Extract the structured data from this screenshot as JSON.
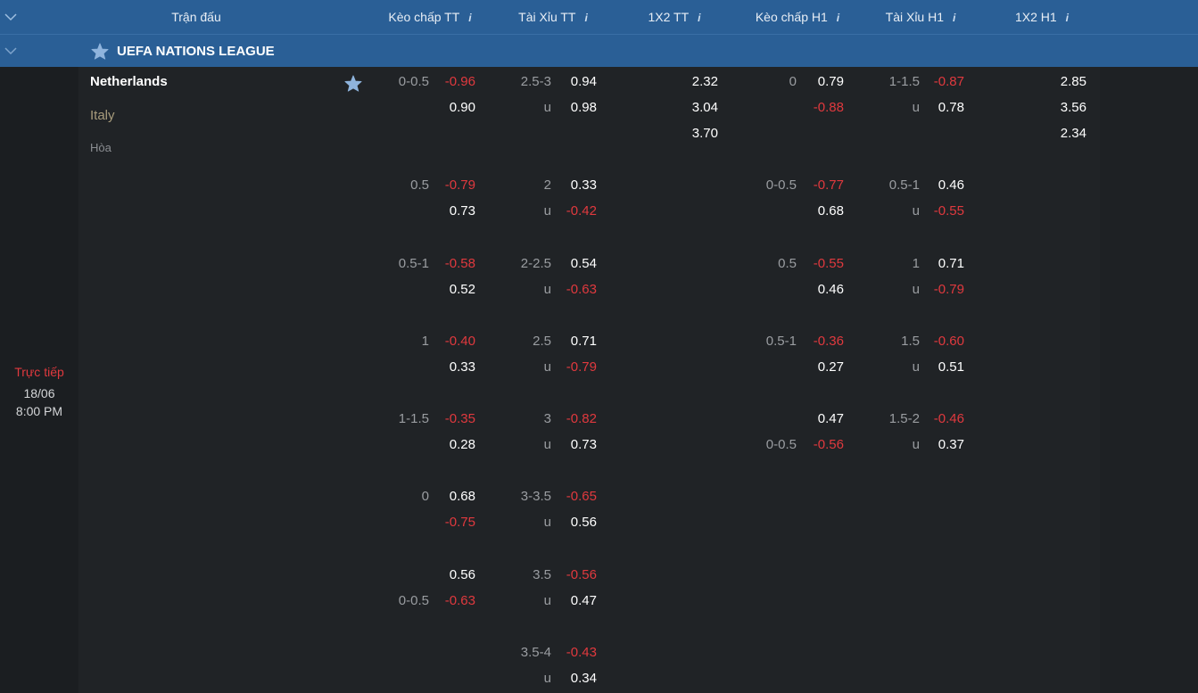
{
  "header": {
    "columns": [
      "Trận đấu",
      "Kèo chấp TT",
      "Tài Xỉu TT",
      "1X2 TT",
      "Kèo chấp H1",
      "Tài Xỉu H1",
      "1X2 H1"
    ],
    "info_mark": "i"
  },
  "league": {
    "name": "UEFA NATIONS LEAGUE"
  },
  "match": {
    "home": "Netherlands",
    "away": "Italy",
    "draw": "Hòa",
    "status": "Trực tiếp",
    "date": "18/06",
    "time": "8:00 PM"
  },
  "colors": {
    "header_bg": "#2a5f96",
    "negative": "#e0393e",
    "positive": "#ffffff",
    "star": "#8fb4dd"
  },
  "x1x2_tt": [
    "2.32",
    "3.04",
    "3.70"
  ],
  "x1x2_h1": [
    "2.85",
    "3.56",
    "2.34"
  ],
  "handicap_tt": [
    {
      "line": "0-0.5",
      "line_row": 0,
      "odds": [
        "-0.96",
        "0.90"
      ]
    },
    {
      "line": "0.5",
      "line_row": 0,
      "odds": [
        "-0.79",
        "0.73"
      ]
    },
    {
      "line": "0.5-1",
      "line_row": 0,
      "odds": [
        "-0.58",
        "0.52"
      ]
    },
    {
      "line": "1",
      "line_row": 0,
      "odds": [
        "-0.40",
        "0.33"
      ]
    },
    {
      "line": "1-1.5",
      "line_row": 0,
      "odds": [
        "-0.35",
        "0.28"
      ]
    },
    {
      "line": "0",
      "line_row": 0,
      "odds": [
        "0.68",
        "-0.75"
      ]
    },
    {
      "line": "0-0.5",
      "line_row": 1,
      "odds": [
        "0.56",
        "-0.63"
      ]
    }
  ],
  "overunder_tt": [
    {
      "line": "2.5-3",
      "u": "u",
      "odds": [
        "0.94",
        "0.98"
      ]
    },
    {
      "line": "2",
      "u": "u",
      "odds": [
        "0.33",
        "-0.42"
      ]
    },
    {
      "line": "2-2.5",
      "u": "u",
      "odds": [
        "0.54",
        "-0.63"
      ]
    },
    {
      "line": "2.5",
      "u": "u",
      "odds": [
        "0.71",
        "-0.79"
      ]
    },
    {
      "line": "3",
      "u": "u",
      "odds": [
        "-0.82",
        "0.73"
      ]
    },
    {
      "line": "3-3.5",
      "u": "u",
      "odds": [
        "-0.65",
        "0.56"
      ]
    },
    {
      "line": "3.5",
      "u": "u",
      "odds": [
        "-0.56",
        "0.47"
      ]
    },
    {
      "line": "3.5-4",
      "u": "u",
      "odds": [
        "-0.43",
        "0.34"
      ]
    }
  ],
  "handicap_h1": [
    {
      "line": "0",
      "line_row": 0,
      "odds": [
        "0.79",
        "-0.88"
      ]
    },
    {
      "line": "0-0.5",
      "line_row": 0,
      "odds": [
        "-0.77",
        "0.68"
      ]
    },
    {
      "line": "0.5",
      "line_row": 0,
      "odds": [
        "-0.55",
        "0.46"
      ]
    },
    {
      "line": "0.5-1",
      "line_row": 0,
      "odds": [
        "-0.36",
        "0.27"
      ]
    },
    {
      "line": "0-0.5",
      "line_row": 1,
      "odds": [
        "0.47",
        "-0.56"
      ]
    }
  ],
  "overunder_h1": [
    {
      "line": "1-1.5",
      "u": "u",
      "odds": [
        "-0.87",
        "0.78"
      ]
    },
    {
      "line": "0.5-1",
      "u": "u",
      "odds": [
        "0.46",
        "-0.55"
      ]
    },
    {
      "line": "1",
      "u": "u",
      "odds": [
        "0.71",
        "-0.79"
      ]
    },
    {
      "line": "1.5",
      "u": "u",
      "odds": [
        "-0.60",
        "0.51"
      ]
    },
    {
      "line": "1.5-2",
      "u": "u",
      "odds": [
        "-0.46",
        "0.37"
      ]
    }
  ]
}
